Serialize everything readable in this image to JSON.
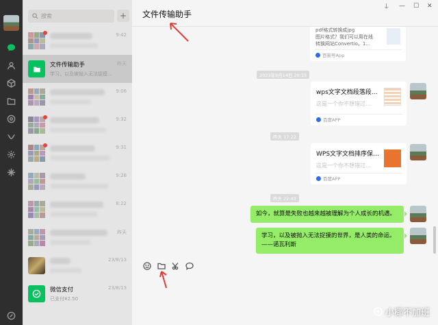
{
  "search": {
    "placeholder": "搜索"
  },
  "sidebar_icons": [
    "chat-icon",
    "contacts-icon",
    "box-icon",
    "folder-icon",
    "moments-icon",
    "miniprogram-icon",
    "settings-icon",
    "spark-icon",
    "phone-icon"
  ],
  "chats": [
    {
      "name": "",
      "time": "9:42",
      "msg": ""
    },
    {
      "name": "文件传输助手",
      "time": "昨天",
      "msg": "学习，以及被抛入无法捉摸…"
    },
    {
      "name": "",
      "time": "9:06",
      "msg": ""
    },
    {
      "name": "",
      "time": "9:32",
      "msg": ""
    },
    {
      "name": "",
      "time": "9:31",
      "msg": ""
    },
    {
      "name": "",
      "time": "9:26",
      "msg": ""
    },
    {
      "name": "",
      "time": "8:22",
      "msg": ""
    },
    {
      "name": "",
      "time": "昨天",
      "msg": ""
    },
    {
      "name": "",
      "time": "23/8/13",
      "msg": ""
    },
    {
      "name": "微信支付",
      "time": "23/8/13",
      "msg": "已支付¥2.50"
    }
  ],
  "header": {
    "title": "文件传输助手",
    "pin": "⍊",
    "min": "—",
    "max": "☐",
    "close": "✕"
  },
  "messages": {
    "card0": {
      "text1": "pdf格式转换成jpg",
      "text2": "图片格式？我们可以用在线",
      "text3": "转换网站Convertio。1...",
      "source": "百家号App"
    },
    "stamp1": "2023年9月14日 20:15",
    "card1": {
      "title": "wps文字文档段落段…",
      "sub": "这是一个你不想错过…",
      "source": "百度APP"
    },
    "stamp2": "昨天 17:22",
    "card2": {
      "title": "WPS文字文档排序保…",
      "sub": "这是一个你不想错过…",
      "source": "百度APP"
    },
    "stamp3": "昨天 22:43",
    "bubble1": "如今，就算是失败也越来越被理解为个人成长的机遇。",
    "bubble2_line1": "学习，以及被抛入无法捉摸的世界，是人类的命运。",
    "bubble2_line2": "——诺瓦利斯"
  },
  "toolbar": [
    "emoji-icon",
    "folder-icon",
    "scissors-icon",
    "chat-bubble-icon"
  ],
  "watermark": "小椰不加班",
  "accent": "#07c160",
  "bubble_color": "#95ec69",
  "annotation_color": "#e53935"
}
